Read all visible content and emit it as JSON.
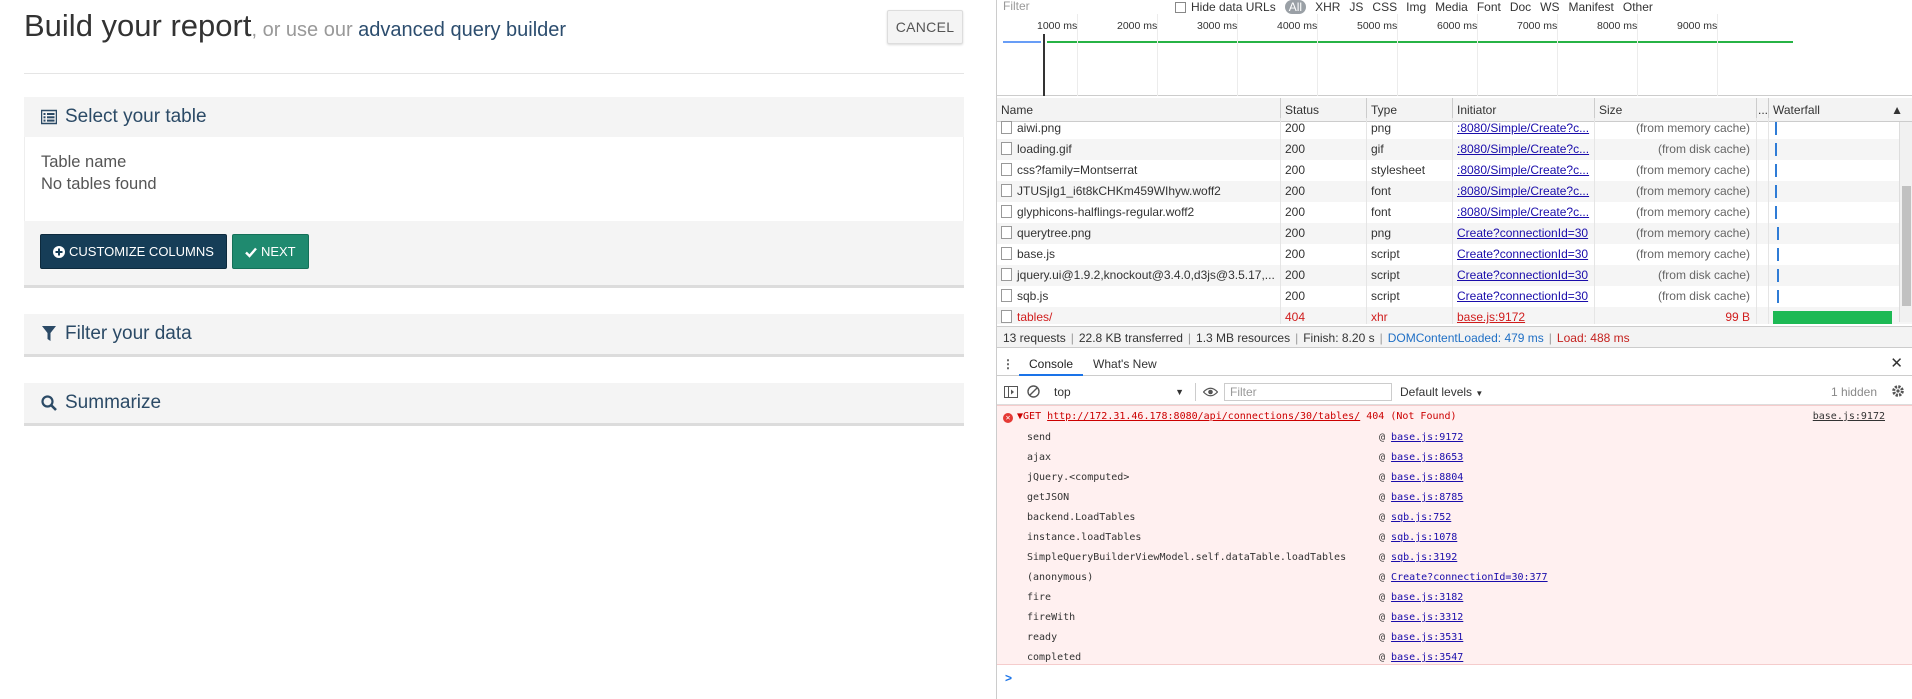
{
  "app": {
    "title": "Build your report",
    "title_or": ", or use our ",
    "title_link": "advanced query builder",
    "cancel_label": "CANCEL",
    "panels": {
      "select_table": {
        "title": "Select your table",
        "field_label": "Table name",
        "field_value": "No tables found",
        "customize_label": "CUSTOMIZE COLUMNS",
        "next_label": "NEXT"
      },
      "filter": {
        "title": "Filter your data"
      },
      "summarize": {
        "title": "Summarize"
      }
    },
    "colors": {
      "brand_dark": "#163d57",
      "brand_green": "#1f8a6f",
      "heading": "#2b4a66"
    }
  },
  "devtools": {
    "filter_bar": {
      "placeholder": "Filter",
      "hide_data_urls": "Hide data URLs",
      "types": [
        "All",
        "XHR",
        "JS",
        "CSS",
        "Img",
        "Media",
        "Font",
        "Doc",
        "WS",
        "Manifest",
        "Other"
      ]
    },
    "overview_ticks": [
      "1000 ms",
      "2000 ms",
      "3000 ms",
      "4000 ms",
      "5000 ms",
      "6000 ms",
      "7000 ms",
      "8000 ms",
      "9000 ms"
    ],
    "columns": {
      "name": "Name",
      "status": "Status",
      "type": "Type",
      "initiator": "Initiator",
      "size": "Size",
      "more": "...",
      "waterfall": "Waterfall"
    },
    "rows": [
      {
        "name": "aiwi.png",
        "status": "200",
        "type": "png",
        "initiator": ":8080/Simple/Create?c...",
        "size": "(from memory cache)",
        "wf": 2,
        "icon": "image"
      },
      {
        "name": "loading.gif",
        "status": "200",
        "type": "gif",
        "initiator": ":8080/Simple/Create?c...",
        "size": "(from disk cache)",
        "wf": 2,
        "icon": "image"
      },
      {
        "name": "css?family=Montserrat",
        "status": "200",
        "type": "stylesheet",
        "initiator": ":8080/Simple/Create?c...",
        "size": "(from memory cache)",
        "wf": 2,
        "icon": "file"
      },
      {
        "name": "JTUSjIg1_i6t8kCHKm459WIhyw.woff2",
        "status": "200",
        "type": "font",
        "initiator": ":8080/Simple/Create?c...",
        "size": "(from memory cache)",
        "wf": 2,
        "icon": "file"
      },
      {
        "name": "glyphicons-halflings-regular.woff2",
        "status": "200",
        "type": "font",
        "initiator": ":8080/Simple/Create?c...",
        "size": "(from memory cache)",
        "wf": 2,
        "icon": "file"
      },
      {
        "name": "querytree.png",
        "status": "200",
        "type": "png",
        "initiator": "Create?connectionId=30",
        "size": "(from memory cache)",
        "wf": 4,
        "icon": "image"
      },
      {
        "name": "base.js",
        "status": "200",
        "type": "script",
        "initiator": "Create?connectionId=30",
        "size": "(from memory cache)",
        "wf": 4,
        "icon": "file"
      },
      {
        "name": "jquery.ui@1.9.2,knockout@3.4.0,d3js@3.5.17,...",
        "status": "200",
        "type": "script",
        "initiator": "Create?connectionId=30",
        "size": "(from disk cache)",
        "wf": 4,
        "icon": "file"
      },
      {
        "name": "sqb.js",
        "status": "200",
        "type": "script",
        "initiator": "Create?connectionId=30",
        "size": "(from disk cache)",
        "wf": 4,
        "icon": "file"
      },
      {
        "name": "tables/",
        "status": "404",
        "type": "xhr",
        "initiator": "base.js:9172",
        "size": "99 B",
        "wf": 0,
        "icon": "file",
        "error": true
      }
    ],
    "summary": {
      "requests": "13 requests",
      "transferred": "22.8 KB transferred",
      "resources": "1.3 MB resources",
      "finish": "Finish: 8.20 s",
      "dcl": "DOMContentLoaded: 479 ms",
      "load": "Load: 488 ms"
    },
    "drawer": {
      "tabs": [
        "Console",
        "What's New"
      ]
    },
    "console_bar": {
      "context": "top",
      "filter_placeholder": "Filter",
      "levels": "Default levels",
      "hidden": "1 hidden"
    },
    "error": {
      "method": "GET",
      "url": "http://172.31.46.178:8080/api/connections/30/tables/",
      "status": "404 (Not Found)",
      "source": "base.js:9172"
    },
    "stack": [
      {
        "fn": "send",
        "src": "base.js:9172"
      },
      {
        "fn": "ajax",
        "src": "base.js:8653"
      },
      {
        "fn": "jQuery.<computed>",
        "src": "base.js:8804"
      },
      {
        "fn": "getJSON",
        "src": "base.js:8785"
      },
      {
        "fn": "backend.LoadTables",
        "src": "sqb.js:752"
      },
      {
        "fn": "instance.loadTables",
        "src": "sqb.js:1078"
      },
      {
        "fn": "SimpleQueryBuilderViewModel.self.dataTable.loadTables",
        "src": "sqb.js:3192"
      },
      {
        "fn": "(anonymous)",
        "src": "Create?connectionId=30:377"
      },
      {
        "fn": "fire",
        "src": "base.js:3182"
      },
      {
        "fn": "fireWith",
        "src": "base.js:3312"
      },
      {
        "fn": "ready",
        "src": "base.js:3531"
      },
      {
        "fn": "completed",
        "src": "base.js:3547"
      }
    ],
    "prompt": ">"
  }
}
